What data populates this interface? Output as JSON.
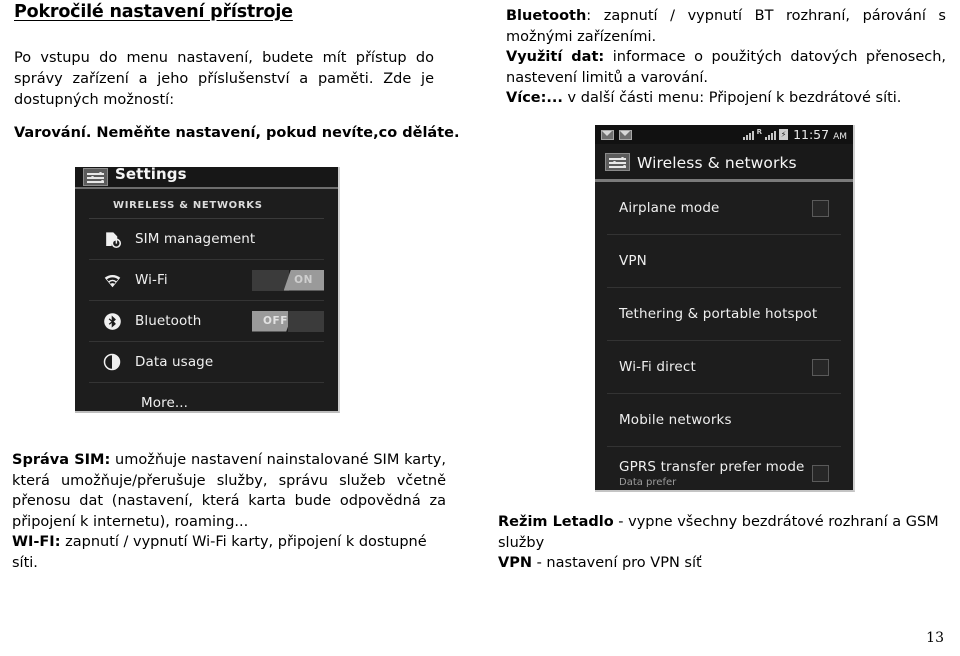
{
  "document": {
    "heading": "Pokročilé nastavení přístroje",
    "intro_paragraph": "Po vstupu do menu nastavení, budete mít přístup do správy zařízení a jeho příslušenství a paměti. Zde je dostupných možností:",
    "warning_line": "Varování. Neměňte nastavení, pokud nevíte,co děláte.",
    "page_number": "13"
  },
  "right_column": {
    "bluetooth_label": "Bluetooth",
    "bluetooth_text": ":  zapnutí / vypnutí BT rozhraní, párování s možnými zařízeními.",
    "data_label": "Využití dat:",
    "data_text": " informace o použitých datových přenosech, nastevení limitů a varování.",
    "more_label": "Více:...",
    "more_text": " v další části menu: Připojení k bezdrátové síti."
  },
  "bottom_left": {
    "sim_label": "Správa SIM:",
    "sim_text": " umožňuje nastavení nainstalované SIM karty, která umožňuje/přerušuje služby, správu služeb včetně přenosu dat (nastavení, která karta bude odpovědná za připojení k internetu), roaming...",
    "wifi_label": "WI-FI:",
    "wifi_text": " zapnutí / vypnutí Wi-Fi karty, připojení k dostupné síti."
  },
  "bottom_right": {
    "airplane_label": "Režim Letadlo",
    "airplane_text": " - vypne všechny bezdrátové rozhraní a GSM služby",
    "vpn_label": "VPN",
    "vpn_text": " - nastavení pro VPN síť"
  },
  "screenshot_left": {
    "title": "Settings",
    "section_header": "WIRELESS & NETWORKS",
    "rows": [
      {
        "label": "SIM management",
        "icon": "sim-card-icon",
        "toggle": null
      },
      {
        "label": "Wi-Fi",
        "icon": "wifi-icon",
        "toggle": "ON"
      },
      {
        "label": "Bluetooth",
        "icon": "bluetooth-icon",
        "toggle": "OFF"
      },
      {
        "label": "Data usage",
        "icon": "pie-chart-icon",
        "toggle": null
      },
      {
        "label": "More...",
        "icon": null,
        "toggle": null
      }
    ]
  },
  "screenshot_right": {
    "status_bar": {
      "time": "11:57",
      "meridiem": "AM",
      "roaming_indicator": "R",
      "battery_glyph": "battery-icon"
    },
    "title": "Wireless & networks",
    "rows": [
      {
        "label": "Airplane mode",
        "subtitle": null,
        "checkbox": true
      },
      {
        "label": "VPN",
        "subtitle": null,
        "checkbox": false
      },
      {
        "label": "Tethering & portable hotspot",
        "subtitle": null,
        "checkbox": false
      },
      {
        "label": "Wi-Fi direct",
        "subtitle": null,
        "checkbox": true
      },
      {
        "label": "Mobile networks",
        "subtitle": null,
        "checkbox": false
      },
      {
        "label": "GPRS transfer prefer mode",
        "subtitle": "Data prefer",
        "checkbox": true
      }
    ]
  },
  "colors": {
    "page_background": "#ffffff",
    "text": "#000000",
    "screenshot_background": "#1d1d1d",
    "screenshot_text": "#f2f2f2",
    "toggle_light": "#9a9a9a",
    "toggle_dark": "#3b3b3b"
  }
}
